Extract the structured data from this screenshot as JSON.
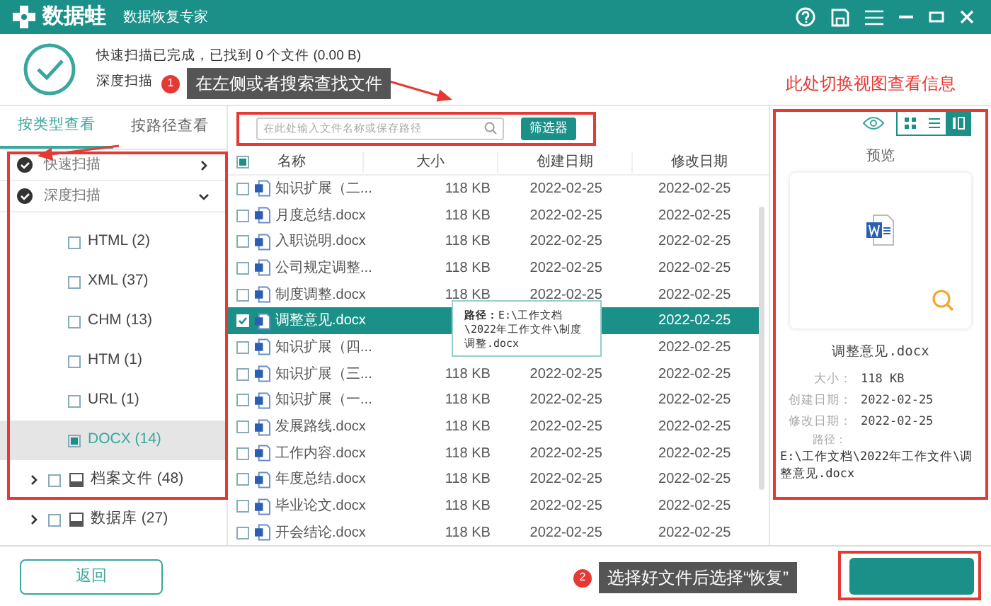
{
  "app": {
    "name": "数据蛙",
    "subtitle": "数据恢复专家"
  },
  "scan_status": [
    "快速扫描已完成，已找到 0 个文件 (0.00 B)",
    "深度扫描"
  ],
  "view_tabs": [
    {
      "label": "按类型查看",
      "selected": true
    },
    {
      "label": "按路径查看",
      "selected": false
    }
  ],
  "tree": [
    {
      "kind": "scan",
      "label": "快速扫描",
      "expanded": false
    },
    {
      "kind": "scan",
      "label": "深度扫描",
      "expanded": true,
      "children": [
        {
          "label": "HTML (2)",
          "checked": false,
          "selected": false
        },
        {
          "label": "XML (37)",
          "checked": false,
          "selected": false
        },
        {
          "label": "CHM (13)",
          "checked": false,
          "selected": false
        },
        {
          "label": "HTM (1)",
          "checked": false,
          "selected": false
        },
        {
          "label": "URL (1)",
          "checked": false,
          "selected": false
        },
        {
          "label": "DOCX (14)",
          "checked": true,
          "selected": true
        }
      ]
    },
    {
      "kind": "category",
      "label": "档案文件 (48)",
      "expanded": false,
      "checked": false
    },
    {
      "kind": "category",
      "label": "数据库 (27)",
      "expanded": false,
      "checked": false
    }
  ],
  "search": {
    "placeholder": "在此处输入文件名称或保存路径"
  },
  "filter_button": "筛选器",
  "view_modes": [
    {
      "kind": "grid",
      "selected": false
    },
    {
      "kind": "list",
      "selected": false
    },
    {
      "kind": "detail",
      "selected": true
    }
  ],
  "table": {
    "columns": [
      "名称",
      "大小",
      "创建日期",
      "修改日期"
    ],
    "partially_checked": true,
    "rows": [
      {
        "name": "知识扩展（二...",
        "size": "118 KB",
        "created": "2022-02-25",
        "modified": "2022-02-25",
        "selected": false
      },
      {
        "name": "月度总结.docx",
        "size": "118 KB",
        "created": "2022-02-25",
        "modified": "2022-02-25",
        "selected": false
      },
      {
        "name": "入职说明.docx",
        "size": "118 KB",
        "created": "2022-02-25",
        "modified": "2022-02-25",
        "selected": false
      },
      {
        "name": "公司规定调整...",
        "size": "118 KB",
        "created": "2022-02-25",
        "modified": "2022-02-25",
        "selected": false
      },
      {
        "name": "制度调整.docx",
        "size": "118 KB",
        "created": "2022-02-25",
        "modified": "2022-02-25",
        "selected": false
      },
      {
        "name": "调整意见.docx",
        "size": "",
        "created": "",
        "modified": "2022-02-25",
        "selected": true
      },
      {
        "name": "知识扩展（四...",
        "size": "",
        "created": "",
        "modified": "2022-02-25",
        "selected": false
      },
      {
        "name": "知识扩展（三...",
        "size": "118 KB",
        "created": "2022-02-25",
        "modified": "2022-02-25",
        "selected": false
      },
      {
        "name": "知识扩展（一...",
        "size": "118 KB",
        "created": "2022-02-25",
        "modified": "2022-02-25",
        "selected": false
      },
      {
        "name": "发展路线.docx",
        "size": "118 KB",
        "created": "2022-02-25",
        "modified": "2022-02-25",
        "selected": false
      },
      {
        "name": "工作内容.docx",
        "size": "118 KB",
        "created": "2022-02-25",
        "modified": "2022-02-25",
        "selected": false
      },
      {
        "name": "年度总结.docx",
        "size": "118 KB",
        "created": "2022-02-25",
        "modified": "2022-02-25",
        "selected": false
      },
      {
        "name": "毕业论文.docx",
        "size": "118 KB",
        "created": "2022-02-25",
        "modified": "2022-02-25",
        "selected": false
      },
      {
        "name": "开会结论.docx",
        "size": "118 KB",
        "created": "2022-02-25",
        "modified": "2022-02-25",
        "selected": false
      }
    ]
  },
  "tooltip": {
    "label": "路径：",
    "text": "E:\\工作文档\\2022年工作文件\\制度调整.docx"
  },
  "preview": {
    "title": "预览",
    "file_name": "调整意见.docx",
    "properties": [
      {
        "label": "大小：",
        "value": "118 KB"
      },
      {
        "label": "创建日期：",
        "value": "2022-02-25"
      },
      {
        "label": "修改日期：",
        "value": "2022-02-25"
      }
    ],
    "path_label": "路径：",
    "path": "E:\\工作文档\\2022年工作文件\\调整意见.docx"
  },
  "back_button": "返回",
  "annotations": [
    {
      "number": "1",
      "text": "在左侧或者搜索查找文件"
    },
    {
      "number": "2",
      "text": "选择好文件后选择“恢复”"
    }
  ],
  "annotation_note": "此处切换视图查看信息"
}
